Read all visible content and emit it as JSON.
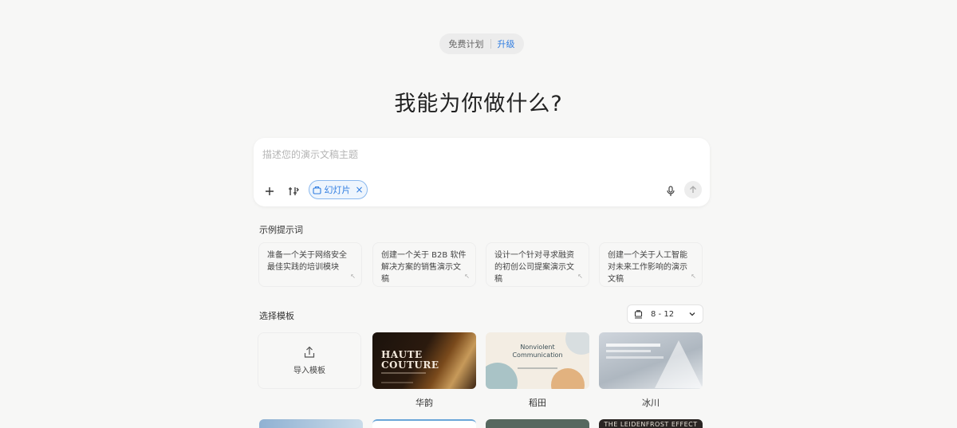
{
  "plan": {
    "free_label": "免费计划",
    "upgrade_label": "升级"
  },
  "headline": "我能为你做什么?",
  "composer": {
    "placeholder": "描述您的演示文稿主题",
    "chip_label": "幻灯片",
    "chip_close": "×"
  },
  "examples": {
    "title": "示例提示词",
    "items": [
      "准备一个关于网络安全最佳实践的培训模块",
      "创建一个关于 B2B 软件解决方案的销售演示文稿",
      "设计一个针对寻求融资的初创公司提案演示文稿",
      "创建一个关于人工智能对未来工作影响的演示文稿"
    ]
  },
  "templates": {
    "title": "选择模板",
    "size_value": "8 - 12",
    "import_label": "导入模板",
    "items": [
      {
        "name": "华韵",
        "slide_text_1": "HAUTE",
        "slide_text_2": "COUTURE"
      },
      {
        "name": "稻田",
        "slide_text_1": "Nonviolent",
        "slide_text_2": "Communication"
      },
      {
        "name": "冰川"
      }
    ],
    "row2_label_4": "THE LEIDENFROST EFFECT"
  },
  "colors": {
    "accent": "#2f7de1",
    "background": "#f7f7f6"
  }
}
